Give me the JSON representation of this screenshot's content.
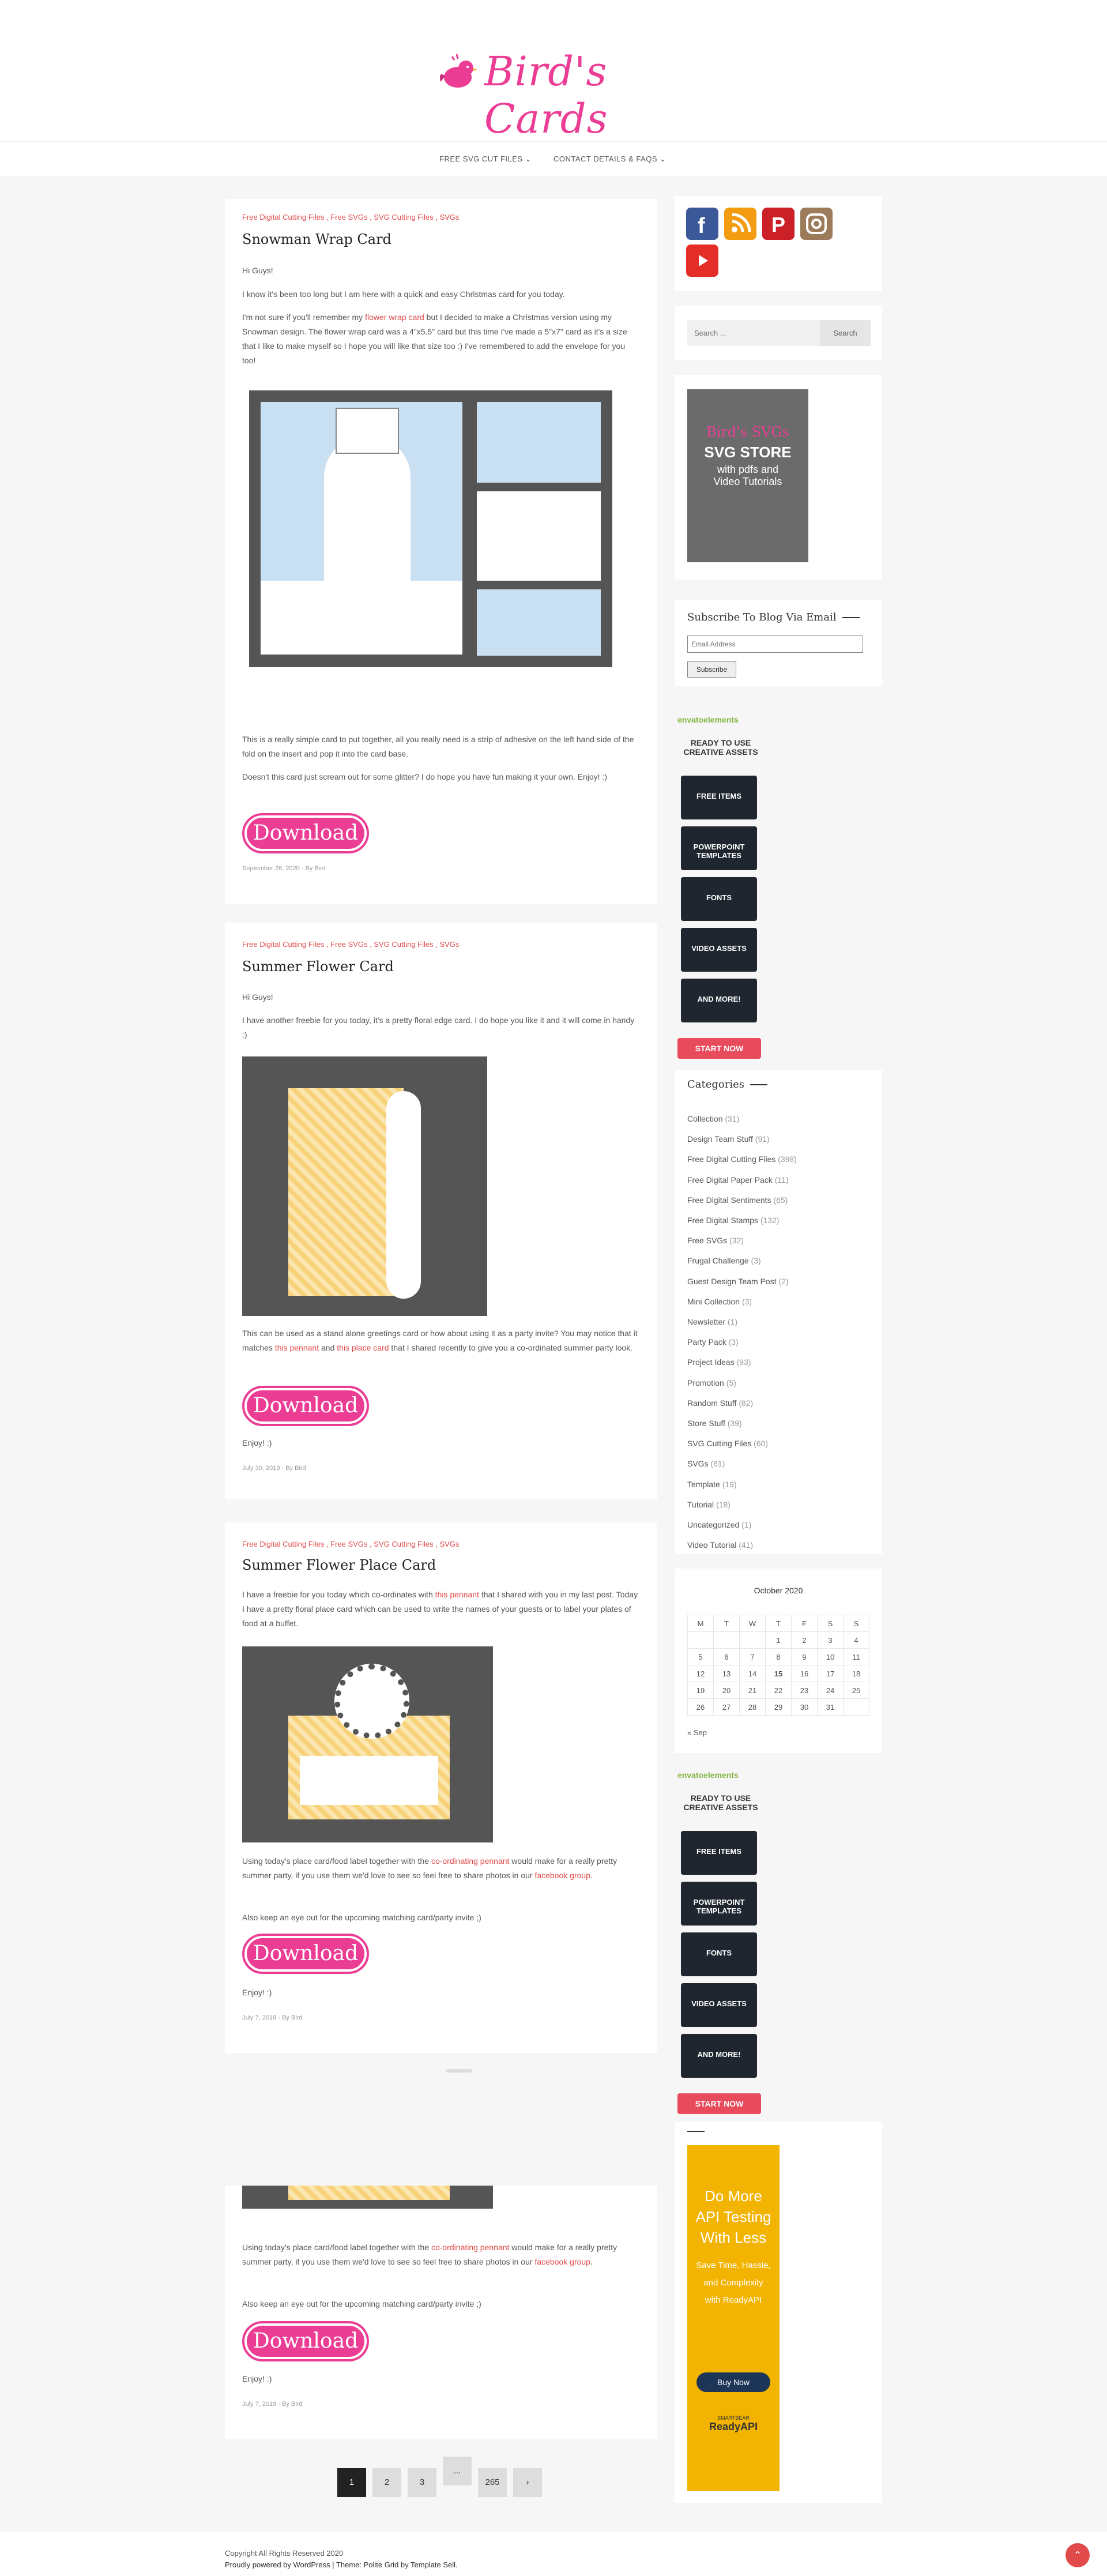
{
  "site": {
    "logo_text": "Bird's Cards"
  },
  "nav": {
    "svg": "FREE SVG CUT FILES",
    "contact": "CONTACT DETAILS & FAQS"
  },
  "cats_line": "Free Digital Cutting Files , Free SVGs , SVG Cutting Files , SVGs",
  "download_label": "Download",
  "posts": [
    {
      "title": "Snowman Wrap Card",
      "p1": "Hi Guys!",
      "p2": "I know it's been too long but I am here with a quick and easy Christmas card for you today.",
      "p3a": "I'm not sure if you'll remember my ",
      "p3link": "flower wrap card",
      "p3b": " but I decided to make a Christmas version using my Snowman design. The flower wrap card was a 4\"x5.5\" card but this time I've made a 5\"x7\" card as it's a size that I like to make myself so I hope you will like that size too :) I've remembered to add the envelope for you too!",
      "p4": "This is a really simple card to put together, all you really need is a strip of adhesive on the left hand side of the fold on the insert and pop it into the card base.",
      "p5": "Doesn't this card just scream out for some glitter? I do hope you have fun making it your own. Enjoy! :)",
      "meta": "September 28, 2020  ·  By Bird"
    },
    {
      "title": "Summer Flower Card",
      "p1": "Hi Guys!",
      "p2": "I have another freebie for you today, it's a pretty floral edge card. I do hope you like it and it will come in handy :)",
      "p3a": "This can be used as a stand alone greetings card or how about using it as a party invite? You may notice that it matches ",
      "p3link": "this pennant",
      "p3mid": " and ",
      "p3link2": "this place card",
      "p3b": " that I shared recently to give you a co-ordinated summer party look.",
      "p4": "Enjoy! :)",
      "meta": "July 30, 2019  ·  By Bird"
    },
    {
      "title": "Summer Flower Place Card",
      "p1a": "I have a freebie for you today which co-ordinates with ",
      "p1link": "this pennant",
      "p1b": " that I shared with you in my last post. Today I have a pretty floral place card which can be used to write the names of your guests or to label your plates of food at a buffet.",
      "p2a": "Using today's place card/food label together with the ",
      "p2link": "co-ordinating pennant",
      "p2b": " would make for a really pretty summer party, if you use them we'd love to see so feel free to share photos in our ",
      "p2link2": "facebook group",
      "p2c": ".",
      "p3": "Also keep an eye out for the upcoming matching card/party invite ;)",
      "p4": "Enjoy! :)",
      "meta": "July 7, 2019  ·  By Bird"
    }
  ],
  "sidebar": {
    "search_placeholder": "Search ...",
    "search_btn": "Search",
    "store": {
      "l1": "Bird's SVGs",
      "l2": "SVG STORE",
      "l3": "with pdfs and",
      "l4": "Video Tutorials"
    },
    "subscribe_title": "Subscribe To Blog Via Email",
    "email_placeholder": "Email Address",
    "subscribe_btn": "Subscribe",
    "categories_title": "Categories",
    "categories": [
      [
        "Collection",
        "(31)"
      ],
      [
        "Design Team Stuff",
        "(91)"
      ],
      [
        "Free Digital Cutting Files",
        "(398)"
      ],
      [
        "Free Digital Paper Pack",
        "(11)"
      ],
      [
        "Free Digital Sentiments",
        "(65)"
      ],
      [
        "Free Digital Stamps",
        "(132)"
      ],
      [
        "Free SVGs",
        "(32)"
      ],
      [
        "Frugal Challenge",
        "(3)"
      ],
      [
        "Guest Design Team Post",
        "(2)"
      ],
      [
        "Mini Collection",
        "(3)"
      ],
      [
        "Newsletter",
        "(1)"
      ],
      [
        "Party Pack",
        "(3)"
      ],
      [
        "Project Ideas",
        "(93)"
      ],
      [
        "Promotion",
        "(5)"
      ],
      [
        "Random Stuff",
        "(82)"
      ],
      [
        "Store Stuff",
        "(39)"
      ],
      [
        "SVG Cutting Files",
        "(60)"
      ],
      [
        "SVGs",
        "(61)"
      ],
      [
        "Template",
        "(19)"
      ],
      [
        "Tutorial",
        "(18)"
      ],
      [
        "Uncategorized",
        "(1)"
      ],
      [
        "Video Tutorial",
        "(41)"
      ]
    ],
    "calendar": {
      "month": "October 2020",
      "days": [
        "M",
        "T",
        "W",
        "T",
        "F",
        "S",
        "S"
      ],
      "rows": [
        [
          "",
          "",
          "",
          "1",
          "2",
          "3",
          "4"
        ],
        [
          "5",
          "6",
          "7",
          "8",
          "9",
          "10",
          "11"
        ],
        [
          "12",
          "13",
          "14",
          "15",
          "16",
          "17",
          "18"
        ],
        [
          "19",
          "20",
          "21",
          "22",
          "23",
          "24",
          "25"
        ],
        [
          "26",
          "27",
          "28",
          "29",
          "30",
          "31",
          ""
        ]
      ],
      "prev": "« Sep"
    },
    "envato": {
      "brand": "envatoelements",
      "headline1": "READY TO USE",
      "headline2": "CREATIVE ASSETS",
      "items": [
        "FREE ITEMS",
        "POWERPOINT TEMPLATES",
        "FONTS",
        "VIDEO ASSETS",
        "AND MORE!"
      ],
      "cta": "START NOW"
    },
    "api_ad": {
      "h1": "Do More",
      "h2": "API Testing",
      "h3": "With Less",
      "s1": "Save Time, Hassle,",
      "s2": "and Complexity",
      "s3": "with ReadyAPI",
      "btn": "Buy Now",
      "brand": "ReadyAPI",
      "brand_small": "SMARTBEAR"
    }
  },
  "pagination": {
    "p1": "1",
    "p2": "2",
    "p3": "3",
    "dots": "...",
    "last": "265",
    "next": "›"
  },
  "footer": {
    "copy": "Copyright All Rights Reserved 2020",
    "powered": "Proudly powered by WordPress | Theme: Polite Grid by Template Sell."
  },
  "colors": {
    "brand": "#ec3d95",
    "link": "#e04a4a"
  }
}
